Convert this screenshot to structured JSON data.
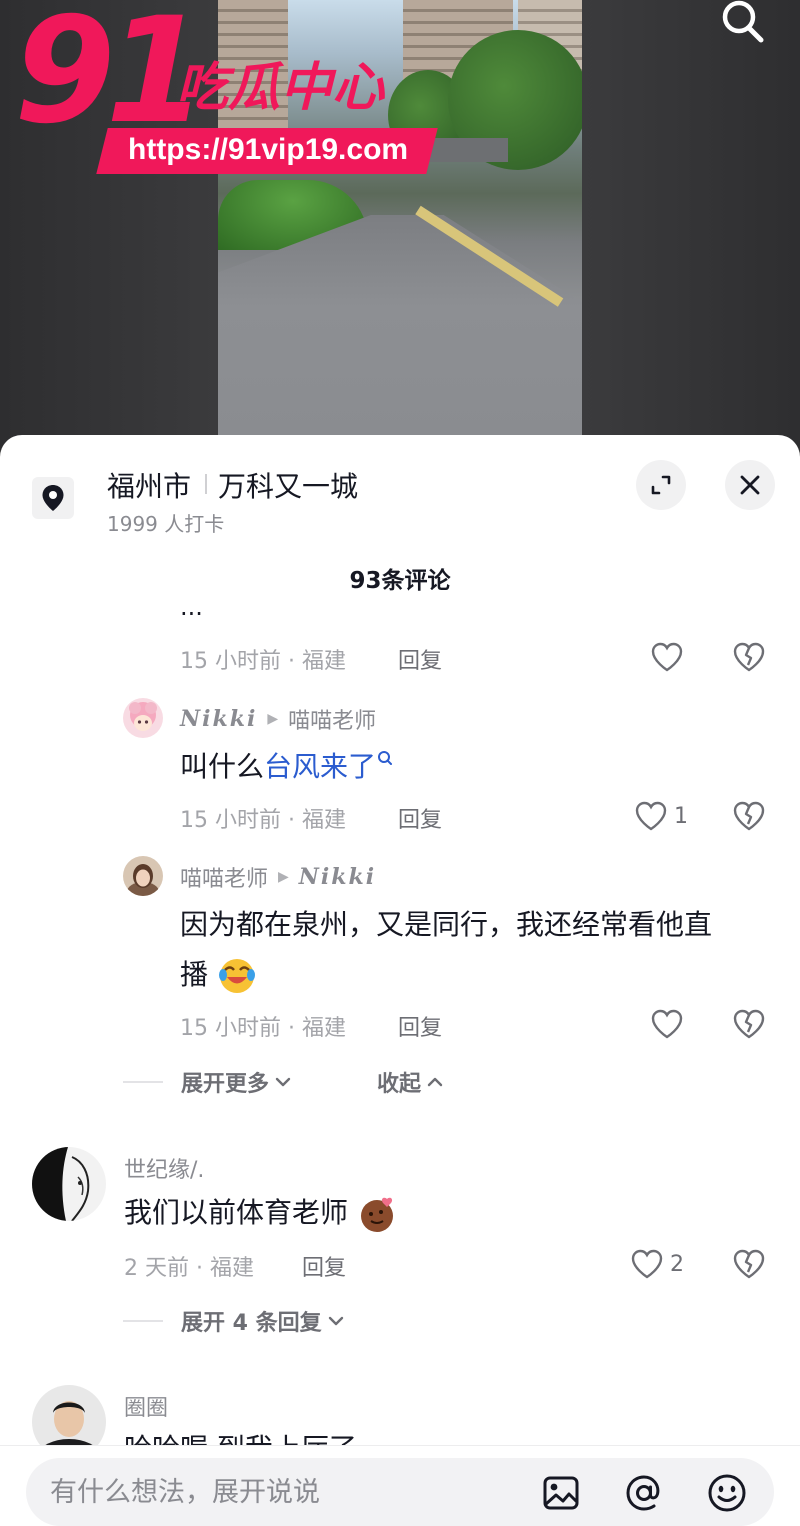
{
  "watermark": {
    "number": "91",
    "title": "吃瓜中心",
    "url": "https://91vip19.com"
  },
  "location": {
    "city": "福州市",
    "place": "万科又一城",
    "checkins": "1999 人打卡"
  },
  "comments_header": {
    "count_label": "93条评论"
  },
  "comments": {
    "cut_text": "...",
    "r0": {
      "meta": "15 小时前 · 福建",
      "reply": "回复"
    },
    "r1": {
      "author": "𝒩𝒾𝓀𝓀𝒾",
      "author_plain": "Nikki",
      "reply_to": "喵喵老师",
      "text_prefix": "叫什么",
      "link_text": "台风来了",
      "meta": "15 小时前 · 福建",
      "reply": "回复",
      "likes": "1"
    },
    "r2": {
      "author": "喵喵老师",
      "reply_to": "Nikki",
      "text_line1": "因为都在泉州，又是同行，我还经常看他直",
      "text_line2": "播",
      "meta": "15 小时前 · 福建",
      "reply": "回复"
    },
    "thread_controls": {
      "expand_more": "展开更多",
      "collapse": "收起"
    },
    "c2": {
      "author": "世纪缘/.",
      "text": "我们以前体育老师",
      "meta": "2 天前 · 福建",
      "reply": "回复",
      "likes": "2",
      "expand_replies": "展开 4 条回复"
    },
    "c3": {
      "author": "圈圈",
      "text_partial": "哈哈喔 到我上厅了"
    }
  },
  "input": {
    "placeholder": "有什么想法，展开说说"
  },
  "colors": {
    "watermark": "#f0185a",
    "link": "#2b5ccf",
    "meta": "#a3a4a9"
  }
}
